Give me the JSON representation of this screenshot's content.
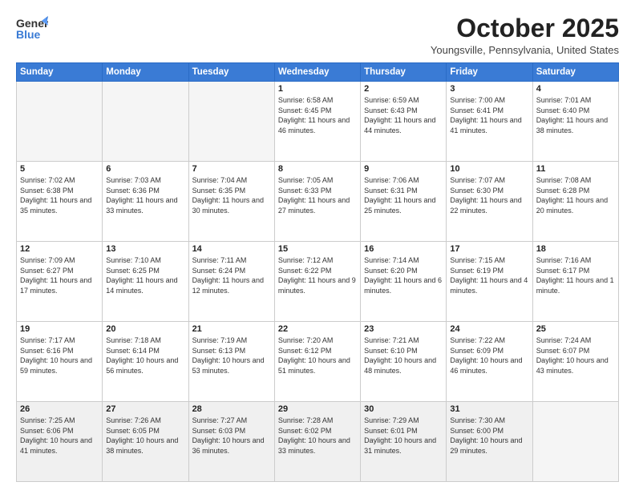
{
  "header": {
    "logo_general": "General",
    "logo_blue": "Blue",
    "month_title": "October 2025",
    "location": "Youngsville, Pennsylvania, United States"
  },
  "days_of_week": [
    "Sunday",
    "Monday",
    "Tuesday",
    "Wednesday",
    "Thursday",
    "Friday",
    "Saturday"
  ],
  "weeks": [
    [
      {
        "day": "",
        "info": ""
      },
      {
        "day": "",
        "info": ""
      },
      {
        "day": "",
        "info": ""
      },
      {
        "day": "1",
        "info": "Sunrise: 6:58 AM\nSunset: 6:45 PM\nDaylight: 11 hours\nand 46 minutes."
      },
      {
        "day": "2",
        "info": "Sunrise: 6:59 AM\nSunset: 6:43 PM\nDaylight: 11 hours\nand 44 minutes."
      },
      {
        "day": "3",
        "info": "Sunrise: 7:00 AM\nSunset: 6:41 PM\nDaylight: 11 hours\nand 41 minutes."
      },
      {
        "day": "4",
        "info": "Sunrise: 7:01 AM\nSunset: 6:40 PM\nDaylight: 11 hours\nand 38 minutes."
      }
    ],
    [
      {
        "day": "5",
        "info": "Sunrise: 7:02 AM\nSunset: 6:38 PM\nDaylight: 11 hours\nand 35 minutes."
      },
      {
        "day": "6",
        "info": "Sunrise: 7:03 AM\nSunset: 6:36 PM\nDaylight: 11 hours\nand 33 minutes."
      },
      {
        "day": "7",
        "info": "Sunrise: 7:04 AM\nSunset: 6:35 PM\nDaylight: 11 hours\nand 30 minutes."
      },
      {
        "day": "8",
        "info": "Sunrise: 7:05 AM\nSunset: 6:33 PM\nDaylight: 11 hours\nand 27 minutes."
      },
      {
        "day": "9",
        "info": "Sunrise: 7:06 AM\nSunset: 6:31 PM\nDaylight: 11 hours\nand 25 minutes."
      },
      {
        "day": "10",
        "info": "Sunrise: 7:07 AM\nSunset: 6:30 PM\nDaylight: 11 hours\nand 22 minutes."
      },
      {
        "day": "11",
        "info": "Sunrise: 7:08 AM\nSunset: 6:28 PM\nDaylight: 11 hours\nand 20 minutes."
      }
    ],
    [
      {
        "day": "12",
        "info": "Sunrise: 7:09 AM\nSunset: 6:27 PM\nDaylight: 11 hours\nand 17 minutes."
      },
      {
        "day": "13",
        "info": "Sunrise: 7:10 AM\nSunset: 6:25 PM\nDaylight: 11 hours\nand 14 minutes."
      },
      {
        "day": "14",
        "info": "Sunrise: 7:11 AM\nSunset: 6:24 PM\nDaylight: 11 hours\nand 12 minutes."
      },
      {
        "day": "15",
        "info": "Sunrise: 7:12 AM\nSunset: 6:22 PM\nDaylight: 11 hours\nand 9 minutes."
      },
      {
        "day": "16",
        "info": "Sunrise: 7:14 AM\nSunset: 6:20 PM\nDaylight: 11 hours\nand 6 minutes."
      },
      {
        "day": "17",
        "info": "Sunrise: 7:15 AM\nSunset: 6:19 PM\nDaylight: 11 hours\nand 4 minutes."
      },
      {
        "day": "18",
        "info": "Sunrise: 7:16 AM\nSunset: 6:17 PM\nDaylight: 11 hours\nand 1 minute."
      }
    ],
    [
      {
        "day": "19",
        "info": "Sunrise: 7:17 AM\nSunset: 6:16 PM\nDaylight: 10 hours\nand 59 minutes."
      },
      {
        "day": "20",
        "info": "Sunrise: 7:18 AM\nSunset: 6:14 PM\nDaylight: 10 hours\nand 56 minutes."
      },
      {
        "day": "21",
        "info": "Sunrise: 7:19 AM\nSunset: 6:13 PM\nDaylight: 10 hours\nand 53 minutes."
      },
      {
        "day": "22",
        "info": "Sunrise: 7:20 AM\nSunset: 6:12 PM\nDaylight: 10 hours\nand 51 minutes."
      },
      {
        "day": "23",
        "info": "Sunrise: 7:21 AM\nSunset: 6:10 PM\nDaylight: 10 hours\nand 48 minutes."
      },
      {
        "day": "24",
        "info": "Sunrise: 7:22 AM\nSunset: 6:09 PM\nDaylight: 10 hours\nand 46 minutes."
      },
      {
        "day": "25",
        "info": "Sunrise: 7:24 AM\nSunset: 6:07 PM\nDaylight: 10 hours\nand 43 minutes."
      }
    ],
    [
      {
        "day": "26",
        "info": "Sunrise: 7:25 AM\nSunset: 6:06 PM\nDaylight: 10 hours\nand 41 minutes."
      },
      {
        "day": "27",
        "info": "Sunrise: 7:26 AM\nSunset: 6:05 PM\nDaylight: 10 hours\nand 38 minutes."
      },
      {
        "day": "28",
        "info": "Sunrise: 7:27 AM\nSunset: 6:03 PM\nDaylight: 10 hours\nand 36 minutes."
      },
      {
        "day": "29",
        "info": "Sunrise: 7:28 AM\nSunset: 6:02 PM\nDaylight: 10 hours\nand 33 minutes."
      },
      {
        "day": "30",
        "info": "Sunrise: 7:29 AM\nSunset: 6:01 PM\nDaylight: 10 hours\nand 31 minutes."
      },
      {
        "day": "31",
        "info": "Sunrise: 7:30 AM\nSunset: 6:00 PM\nDaylight: 10 hours\nand 29 minutes."
      },
      {
        "day": "",
        "info": ""
      }
    ]
  ]
}
